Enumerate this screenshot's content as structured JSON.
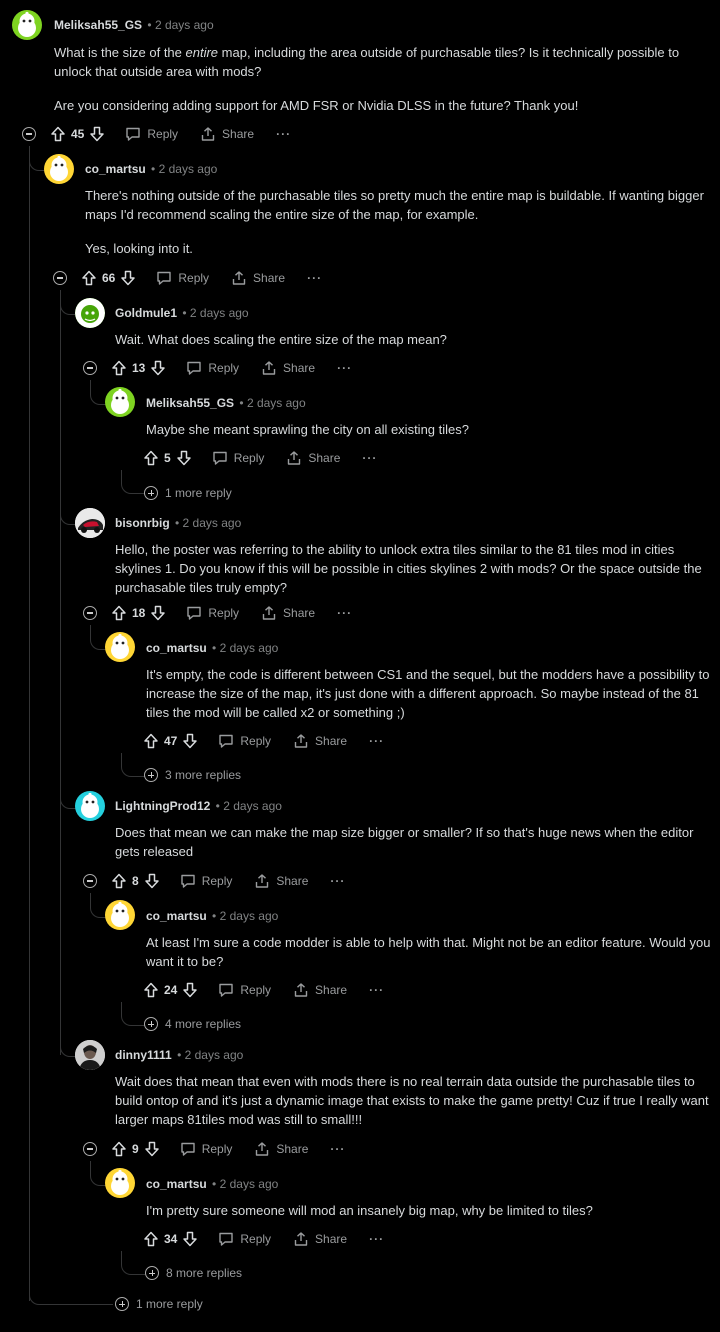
{
  "comments": [
    {
      "username": "Meliksah55_GS",
      "time": "• 2 days ago",
      "body_parts": [
        "What is the size of the ",
        "entire",
        " map, including the area outside of purchasable tiles? Is it technically possible to unlock that outside area with mods?"
      ],
      "body_2": "Are you considering adding support for AMD FSR or Nvidia DLSS in the future? Thank you!",
      "votes": "45",
      "avatar": "green-snoo"
    },
    {
      "username": "co_martsu",
      "time": "• 2 days ago",
      "body": "There's nothing outside of the purchasable tiles so pretty much the entire map is buildable. If wanting bigger maps I'd recommend scaling the entire size of the map, for example.",
      "body_2": "Yes, looking into it.",
      "votes": "66",
      "avatar": "yellow-snoo"
    },
    {
      "username": "Goldmule1",
      "time": "• 2 days ago",
      "body": "Wait. What does scaling the entire size of the map mean?",
      "votes": "13",
      "avatar": "goldmule-snoo"
    },
    {
      "username": "Meliksah55_GS",
      "time": "• 2 days ago",
      "body": "Maybe she meant sprawling the city on all existing tiles?",
      "votes": "5",
      "avatar": "green-snoo",
      "more": "1 more reply"
    },
    {
      "username": "bisonrbig",
      "time": "• 2 days ago",
      "body": "Hello, the poster was referring to the ability to unlock extra tiles similar to the 81 tiles mod in cities skylines 1. Do you know if this will be possible in cities skylines 2 with mods? Or the space outside the purchasable tiles truly empty?",
      "votes": "18",
      "avatar": "car-photo"
    },
    {
      "username": "co_martsu",
      "time": "• 2 days ago",
      "body": "It's empty, the code is different between CS1 and the sequel, but the modders have a possibility to increase the size of the map, it's just done with a different approach. So maybe instead of the 81 tiles the mod will be called x2 or something ;)",
      "votes": "47",
      "avatar": "yellow-snoo",
      "more": "3 more replies"
    },
    {
      "username": "LightningProd12",
      "time": "• 2 days ago",
      "body": "Does that mean we can make the map size bigger or smaller? If so that's huge news when the editor gets released",
      "votes": "8",
      "avatar": "cyan-snoo"
    },
    {
      "username": "co_martsu",
      "time": "• 2 days ago",
      "body": "At least I'm sure a code modder is able to help with that. Might not be an editor feature. Would you want it to be?",
      "votes": "24",
      "avatar": "yellow-snoo",
      "more": "4 more replies"
    },
    {
      "username": "dinny1111",
      "time": "• 2 days ago",
      "body": "Wait does that mean that even with mods there is no real terrain data outside the purchasable tiles to build ontop of and it's just a dynamic image that exists to make the game pretty! Cuz if true I really want larger maps 81tiles mod was still to small!!!",
      "votes": "9",
      "avatar": "person-photo"
    },
    {
      "username": "co_martsu",
      "time": "• 2 days ago",
      "body": "I'm pretty sure someone will mod an insanely big map, why be limited to tiles?",
      "votes": "34",
      "avatar": "yellow-snoo",
      "more": "8 more replies"
    }
  ],
  "labels": {
    "reply": "Reply",
    "share": "Share",
    "more_dots": "···"
  },
  "bottom_more": "1 more reply",
  "colors": {
    "background": "#000000",
    "text": "#d7dadc",
    "muted": "#818384",
    "thread_line": "#343536"
  }
}
